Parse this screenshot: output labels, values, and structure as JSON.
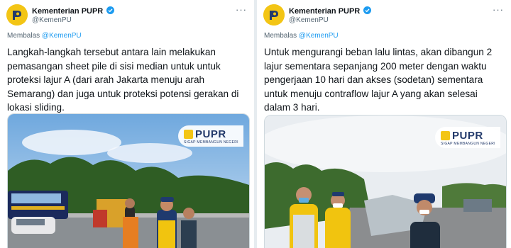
{
  "tweets": [
    {
      "account_name": "Kementerian PUPR",
      "handle": "@KemenPU",
      "replying_label": "Membalas",
      "replying_to": "@KemenPU",
      "text": "Langkah-langkah tersebut antara lain melakukan pemasangan sheet pile di sisi median untuk untuk proteksi lajur A (dari arah Jakarta menuju arah Semarang) dan juga untuk proteksi potensi gerakan di lokasi sliding.",
      "photo_logo": "PUPR",
      "photo_tagline": "SIGAP MEMBANGUN NEGERI"
    },
    {
      "account_name": "Kementerian PUPR",
      "handle": "@KemenPU",
      "replying_label": "Membalas",
      "replying_to": "@KemenPU",
      "text": "Untuk mengurangi beban lalu lintas, akan dibangun 2 lajur sementara sepanjang 200 meter dengan waktu pengerjaan 10 hari dan akses (sodetan) sementara untuk menuju contraflow lajur A yang akan selesai dalam 3 hari.",
      "photo_logo": "PUPR",
      "photo_tagline": "SIGAP MEMBANGUN NEGERI"
    }
  ],
  "icons": {
    "verified": "verified-badge-icon",
    "more": "more-options-icon",
    "avatar": "pupr-logo-avatar"
  },
  "colors": {
    "accent": "#1d9bf0",
    "text": "#0f1419",
    "muted": "#536471",
    "brand_yellow": "#f3c515",
    "brand_navy": "#233a6b"
  }
}
